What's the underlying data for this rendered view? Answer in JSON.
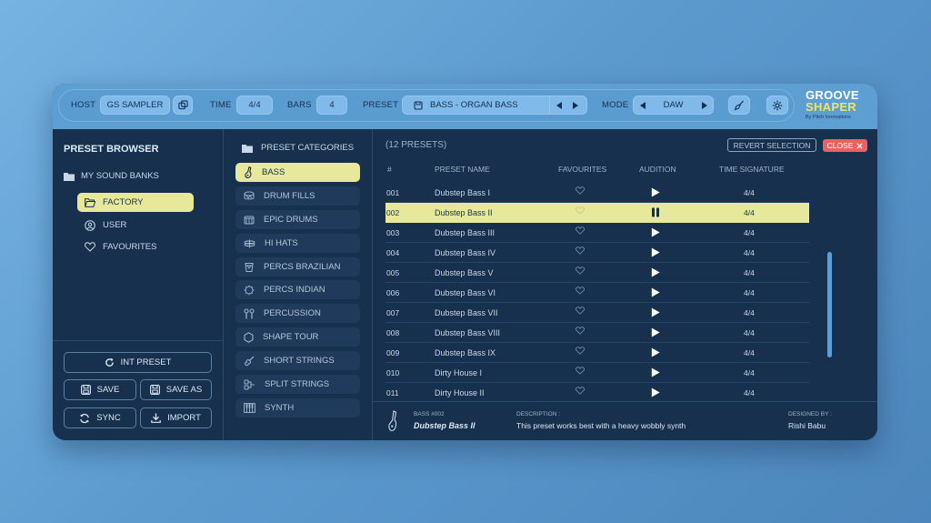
{
  "header": {
    "host_label": "HOST",
    "host_value": "GS SAMPLER",
    "time_label": "TIME",
    "time_value": "4/4",
    "bars_label": "BARS",
    "bars_value": "4",
    "preset_label": "PRESET",
    "preset_value": "BASS - ORGAN BASS",
    "mode_label": "MODE",
    "mode_value": "DAW"
  },
  "logo": {
    "line1": "GROOVE",
    "line2": "SHAPER",
    "tagline": "By Pitch Innovations"
  },
  "browser": {
    "title": "PRESET BROWSER",
    "root": "MY SOUND BANKS",
    "items": [
      {
        "label": "FACTORY",
        "icon": "folder-open-icon",
        "active": true
      },
      {
        "label": "USER",
        "icon": "user-icon",
        "active": false
      },
      {
        "label": "FAVOURITES",
        "icon": "heart-icon",
        "active": false
      }
    ],
    "buttons": {
      "init": "INT PRESET",
      "save": "SAVE",
      "save_as": "SAVE AS",
      "sync": "SYNC",
      "import": "IMPORT"
    }
  },
  "categories": {
    "title": "PRESET CATEGORIES",
    "items": [
      {
        "label": "BASS",
        "icon": "bass-guitar-icon",
        "active": true
      },
      {
        "label": "DRUM FILLS",
        "icon": "drum-fills-icon",
        "active": false
      },
      {
        "label": "EPIC DRUMS",
        "icon": "epic-drums-icon",
        "active": false
      },
      {
        "label": "HI HATS",
        "icon": "hi-hat-icon",
        "active": false
      },
      {
        "label": "PERCS BRAZILIAN",
        "icon": "brazilian-perc-icon",
        "active": false
      },
      {
        "label": "PERCS INDIAN",
        "icon": "indian-perc-icon",
        "active": false
      },
      {
        "label": "PERCUSSION",
        "icon": "percussion-icon",
        "active": false
      },
      {
        "label": "SHAPE TOUR",
        "icon": "hexagon-icon",
        "active": false
      },
      {
        "label": "SHORT STRINGS",
        "icon": "violin-icon",
        "active": false
      },
      {
        "label": "SPLIT STRINGS",
        "icon": "split-strings-icon",
        "active": false
      },
      {
        "label": "SYNTH",
        "icon": "synth-keys-icon",
        "active": false
      }
    ]
  },
  "presets": {
    "count": "(12 PRESETS)",
    "revert": "REVERT SELECTION",
    "close": "CLOSE",
    "columns": [
      "#",
      "PRESET NAME",
      "FAVOURITES",
      "AUDITION",
      "TIME SIGNATURE"
    ],
    "rows": [
      {
        "num": "001",
        "name": "Dubstep Bass I",
        "ts": "4/4",
        "playing": false,
        "active": false
      },
      {
        "num": "002",
        "name": "Dubstep Bass II",
        "ts": "4/4",
        "playing": true,
        "active": true
      },
      {
        "num": "003",
        "name": "Dubstep Bass III",
        "ts": "4/4",
        "playing": false,
        "active": false
      },
      {
        "num": "004",
        "name": "Dubstep Bass IV",
        "ts": "4/4",
        "playing": false,
        "active": false
      },
      {
        "num": "005",
        "name": "Dubstep Bass V",
        "ts": "4/4",
        "playing": false,
        "active": false
      },
      {
        "num": "006",
        "name": "Dubstep Bass VI",
        "ts": "4/4",
        "playing": false,
        "active": false
      },
      {
        "num": "007",
        "name": "Dubstep Bass VII",
        "ts": "4/4",
        "playing": false,
        "active": false
      },
      {
        "num": "008",
        "name": "Dubstep Bass VIII",
        "ts": "4/4",
        "playing": false,
        "active": false
      },
      {
        "num": "009",
        "name": "Dubstep Bass IX",
        "ts": "4/4",
        "playing": false,
        "active": false
      },
      {
        "num": "010",
        "name": "Dirty House I",
        "ts": "4/4",
        "playing": false,
        "active": false
      },
      {
        "num": "011",
        "name": "Dirty House II",
        "ts": "4/4",
        "playing": false,
        "active": false
      }
    ]
  },
  "footer": {
    "preset_no": "BASS #002",
    "preset_name": "Dubstep Bass II",
    "desc_label": "DESCRIPTION :",
    "desc": "This preset works best with a heavy wobbly synth",
    "designer_label": "DESIGNED BY :",
    "designer": "Rishi Babu"
  },
  "colors": {
    "accent_yellow": "#e8e89a",
    "close_red": "#ea6161",
    "panel": "#17304d",
    "header": "#5d9ed3"
  }
}
